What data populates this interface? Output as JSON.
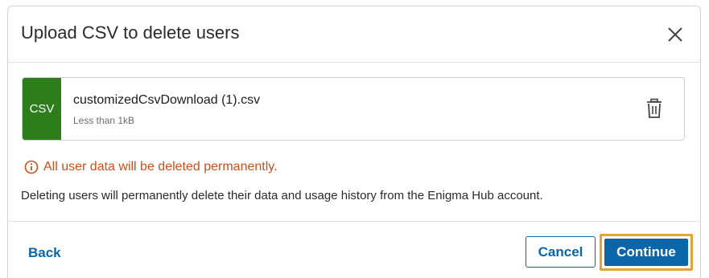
{
  "dialog": {
    "title": "Upload CSV to delete users",
    "close_icon": "close-icon"
  },
  "file": {
    "badge": "CSV",
    "name": "customizedCsvDownload (1).csv",
    "size": "Less than 1kB",
    "delete_icon": "trash-icon",
    "badge_color": "#2e7d1b"
  },
  "warning": {
    "icon": "info-circle-icon",
    "text": "All user data will be deleted permanently.",
    "color": "#c5511b"
  },
  "info": {
    "text": "Deleting users will permanently delete their data and usage history from the Enigma Hub account."
  },
  "footer": {
    "back_label": "Back",
    "cancel_label": "Cancel",
    "continue_label": "Continue",
    "accent_color": "#0a66a8",
    "focus_color": "#e3a33b"
  }
}
